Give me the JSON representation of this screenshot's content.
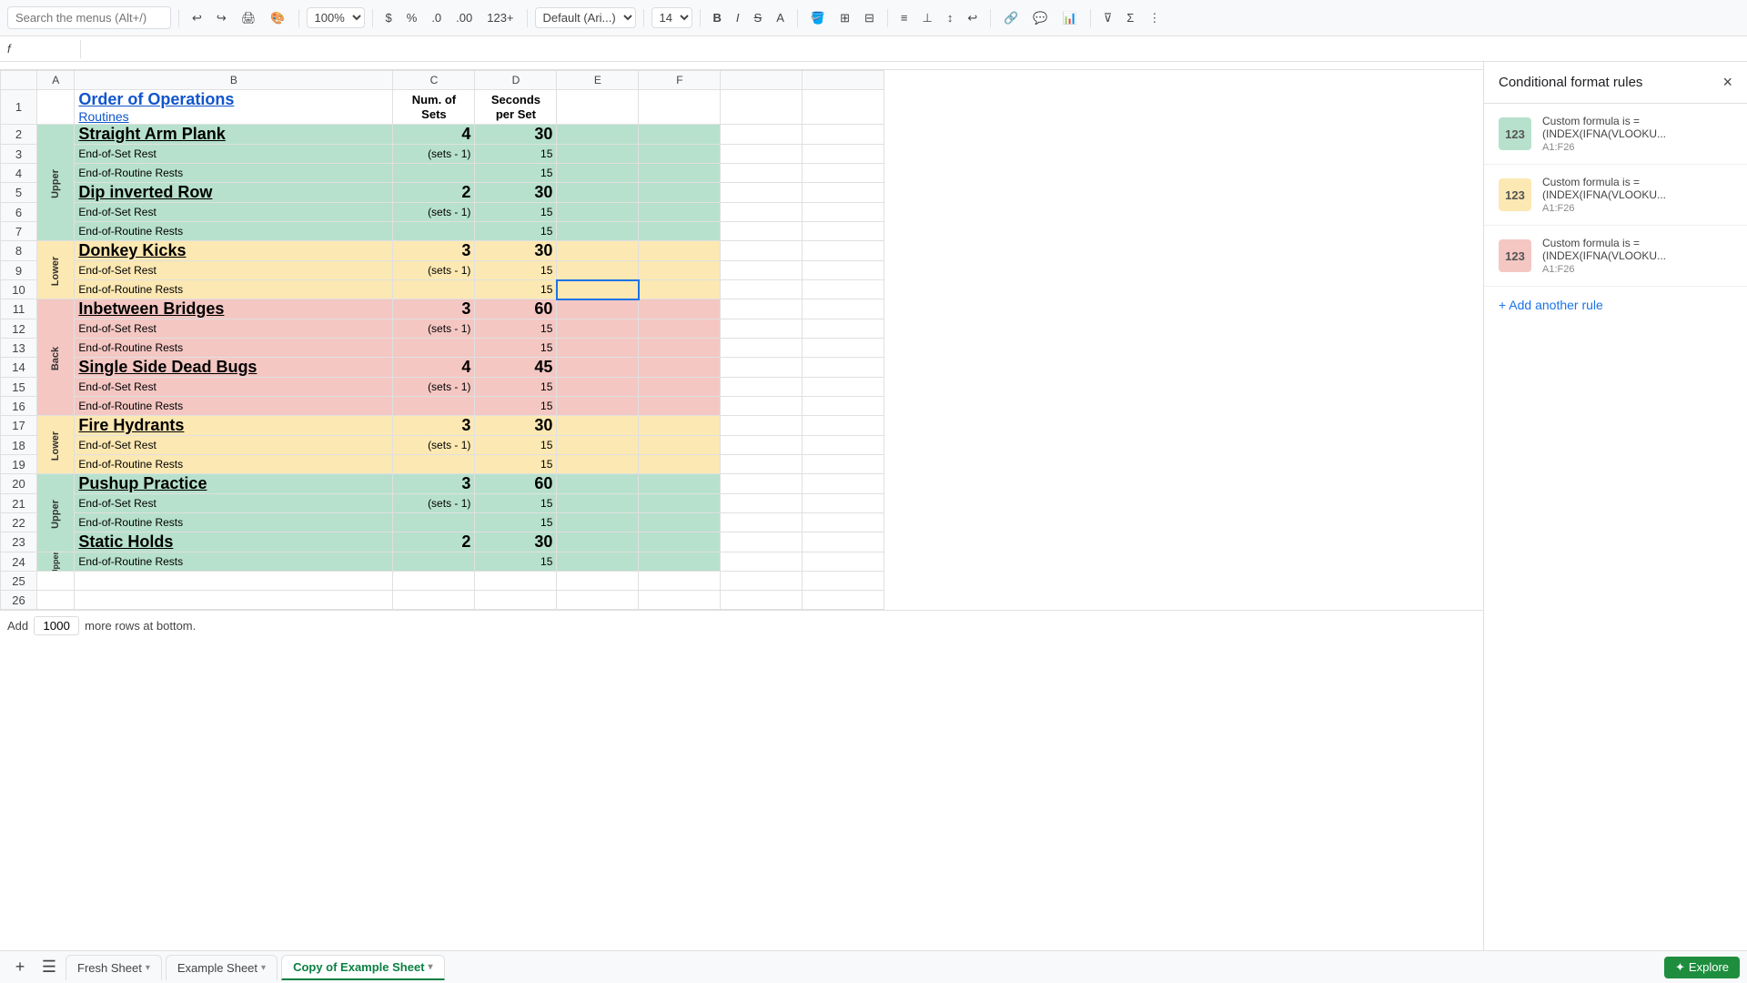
{
  "toolbar": {
    "search_placeholder": "Search the menus (Alt+/)",
    "zoom": "100%",
    "currency": "$",
    "percent": "%",
    "decimal1": ".0",
    "decimal2": ".00",
    "format": "123+",
    "font": "Default (Ari...)",
    "font_size": "14",
    "more_formats": "▾"
  },
  "formula_bar": {
    "cell_ref": "",
    "formula": ""
  },
  "sheet": {
    "columns": [
      "",
      "A",
      "B",
      "C",
      "D",
      "E",
      "F"
    ],
    "col_labels": [
      "Num. of Sets",
      "Seconds per Set"
    ],
    "header_row": {
      "title": "Order of Operations",
      "subtitle": "Routines",
      "col_c": "Num. of\nSets",
      "col_d": "Seconds\nper Set"
    },
    "rows": [
      {
        "row": 2,
        "category": "Upper",
        "name": "Straight Arm Plank",
        "sets": "4",
        "seconds": "30",
        "bg": "green",
        "exercise": true
      },
      {
        "row": 3,
        "category": "",
        "name": "End-of-Set Rest",
        "sets": "(sets - 1)",
        "seconds": "15",
        "bg": "green"
      },
      {
        "row": 4,
        "category": "",
        "name": "End-of-Routine Rests",
        "sets": "",
        "seconds": "15",
        "bg": "green"
      },
      {
        "row": 5,
        "category": "Upper",
        "name": "Dip inverted Row",
        "sets": "2",
        "seconds": "30",
        "bg": "green",
        "exercise": true
      },
      {
        "row": 6,
        "category": "",
        "name": "End-of-Set Rest",
        "sets": "(sets - 1)",
        "seconds": "15",
        "bg": "green"
      },
      {
        "row": 7,
        "category": "",
        "name": "End-of-Routine Rests",
        "sets": "",
        "seconds": "15",
        "bg": "green"
      },
      {
        "row": 8,
        "category": "Lower",
        "name": "Donkey Kicks",
        "sets": "3",
        "seconds": "30",
        "bg": "yellow",
        "exercise": true
      },
      {
        "row": 9,
        "category": "",
        "name": "End-of-Set Rest",
        "sets": "(sets - 1)",
        "seconds": "15",
        "bg": "yellow"
      },
      {
        "row": 10,
        "category": "",
        "name": "End-of-Routine Rests",
        "sets": "",
        "seconds": "15",
        "bg": "yellow",
        "selected_e": true
      },
      {
        "row": 11,
        "category": "Back",
        "name": "Inbetween Bridges",
        "sets": "3",
        "seconds": "60",
        "bg": "red",
        "exercise": true
      },
      {
        "row": 12,
        "category": "",
        "name": "End-of-Set Rest",
        "sets": "(sets - 1)",
        "seconds": "15",
        "bg": "red"
      },
      {
        "row": 13,
        "category": "",
        "name": "End-of-Routine Rests",
        "sets": "",
        "seconds": "15",
        "bg": "red"
      },
      {
        "row": 14,
        "category": "Back",
        "name": "Single Side Dead Bugs",
        "sets": "4",
        "seconds": "45",
        "bg": "red",
        "exercise": true
      },
      {
        "row": 15,
        "category": "",
        "name": "End-of-Set Rest",
        "sets": "(sets - 1)",
        "seconds": "15",
        "bg": "red"
      },
      {
        "row": 16,
        "category": "",
        "name": "End-of-Routine Rests",
        "sets": "",
        "seconds": "15",
        "bg": "red"
      },
      {
        "row": 17,
        "category": "Lower",
        "name": "Fire Hydrants",
        "sets": "3",
        "seconds": "30",
        "bg": "yellow",
        "exercise": true
      },
      {
        "row": 18,
        "category": "",
        "name": "End-of-Set Rest",
        "sets": "(sets - 1)",
        "seconds": "15",
        "bg": "yellow"
      },
      {
        "row": 19,
        "category": "",
        "name": "End-of-Routine Rests",
        "sets": "",
        "seconds": "15",
        "bg": "yellow"
      },
      {
        "row": 20,
        "category": "Upper",
        "name": "Pushup Practice",
        "sets": "3",
        "seconds": "60",
        "bg": "green",
        "exercise": true
      },
      {
        "row": 21,
        "category": "",
        "name": "End-of-Set Rest",
        "sets": "(sets - 1)",
        "seconds": "15",
        "bg": "green"
      },
      {
        "row": 22,
        "category": "",
        "name": "End-of-Routine Rests",
        "sets": "",
        "seconds": "15",
        "bg": "green"
      },
      {
        "row": 23,
        "category": "Upper",
        "name": "Static Holds",
        "sets": "2",
        "seconds": "30",
        "bg": "green",
        "exercise": true
      },
      {
        "row": 24,
        "category": "",
        "name": "End-of-Routine Rests",
        "sets": "",
        "seconds": "15",
        "bg": "green"
      },
      {
        "row": 25,
        "category": "",
        "name": "",
        "sets": "",
        "seconds": "",
        "bg": ""
      },
      {
        "row": 26,
        "category": "",
        "name": "",
        "sets": "",
        "seconds": "",
        "bg": ""
      }
    ]
  },
  "right_panel": {
    "title": "Conditional format rules",
    "close_label": "×",
    "rules": [
      {
        "id": 1,
        "color": "#b7e1cd",
        "text_color": "#333",
        "badge": "123",
        "formula": "Custom formula is =",
        "formula_detail": "(INDEX(IFNA(VLOOKU...",
        "range": "A1:F26"
      },
      {
        "id": 2,
        "color": "#fce8b2",
        "text_color": "#333",
        "badge": "123",
        "formula": "Custom formula is =",
        "formula_detail": "(INDEX(IFNA(VLOOKU...",
        "range": "A1:F26"
      },
      {
        "id": 3,
        "color": "#f4c7c3",
        "text_color": "#333",
        "badge": "123",
        "formula": "Custom formula is =",
        "formula_detail": "(INDEX(IFNA(VLOOKU...",
        "range": "A1:F26"
      }
    ],
    "add_rule_label": "+ Add another rule"
  },
  "bottom_bar": {
    "add_sheet_label": "+",
    "menu_label": "☰",
    "sheets": [
      {
        "name": "Fresh Sheet",
        "active": false,
        "has_arrow": true
      },
      {
        "name": "Example Sheet",
        "active": false,
        "has_arrow": true
      },
      {
        "name": "Copy of Example Sheet",
        "active": true,
        "has_arrow": true
      }
    ],
    "explore_label": "Explore",
    "add_rows_add": "Add",
    "add_rows_count": "1000",
    "add_rows_text": "more rows at bottom."
  }
}
